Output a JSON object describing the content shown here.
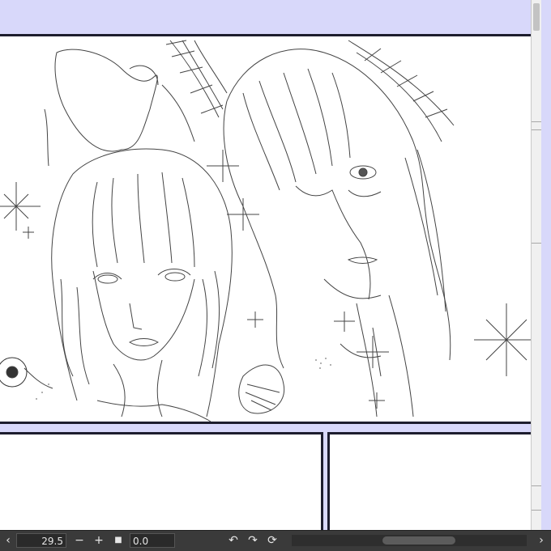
{
  "status_bar": {
    "zoom_value": "29.5",
    "zoom_out_label": "−",
    "zoom_in_label": "+",
    "stop_label": "■",
    "rotation_value": "0.0",
    "undo_icon": "↶",
    "redo_icon": "↷",
    "reset_icon": "⟳",
    "scroll_left_icon": "‹",
    "scroll_right_icon": "›"
  },
  "colors": {
    "canvas_bg": "#d8d8fa",
    "panel_border": "#1d1d2e",
    "status_bg": "#3a3a3a"
  },
  "artwork": {
    "description_icon": "manga-line-art-two-characters"
  }
}
